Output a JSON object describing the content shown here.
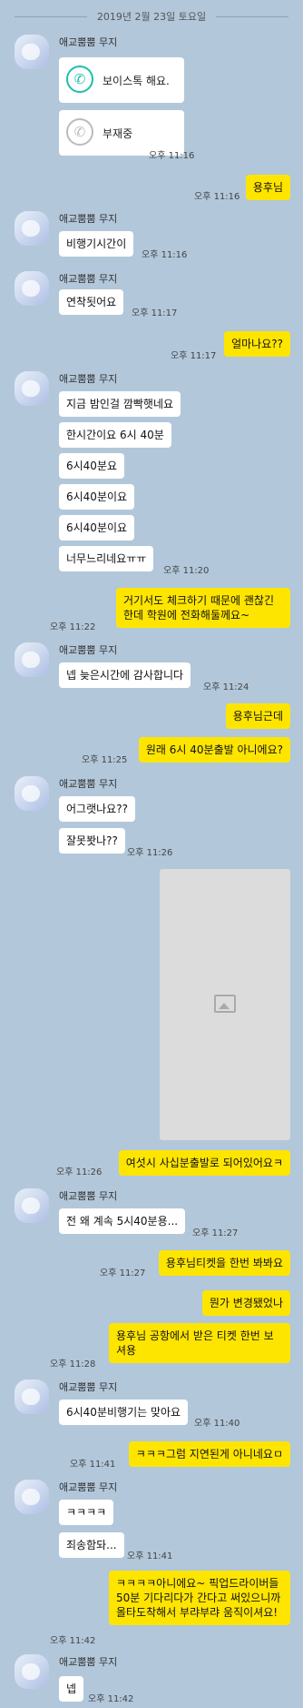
{
  "date_separator": "2019년 2월 23일 토요일",
  "sender_name": "애교뿜뿜 무지",
  "calls": [
    {
      "label": "보이스톡 해요.",
      "type": "voice-call"
    },
    {
      "label": "부재중",
      "type": "missed-call",
      "time": "오후 11:16"
    }
  ],
  "messages": {
    "m1": {
      "text": "용후님",
      "time": "오후 11:16"
    },
    "m2": {
      "text": "비행기시간이",
      "time": "오후 11:16"
    },
    "m3": {
      "text": "연착됫어요",
      "time": "오후 11:17"
    },
    "m4": {
      "text": "얼마나요??",
      "time": "오후 11:17"
    },
    "m5a": {
      "text": "지금 밤인걸 깜빡햇네요"
    },
    "m5b": {
      "text": "한시간이요 6시 40분"
    },
    "m5c": {
      "text": "6시40분요"
    },
    "m5d": {
      "text": "6시40분이요"
    },
    "m5e": {
      "text": "6시40분이요"
    },
    "m5f": {
      "text": "너무느리네요ㅠㅠ",
      "time": "오후 11:20"
    },
    "m6": {
      "text": "거기서도 체크하기 때문에 괜찮긴한데 학원에 전화해둘께요~",
      "time": "오후 11:22"
    },
    "m7": {
      "text": "넵 늦은시간에 감사합니다",
      "time": "오후 11:24"
    },
    "m8a": {
      "text": "용후님근데"
    },
    "m8b": {
      "text": "원래 6시 40분출발 아니에요?",
      "time": "오후 11:25"
    },
    "m9a": {
      "text": "어그랫나요??"
    },
    "m9b": {
      "text": "잘못봣나??",
      "time": "오후 11:26"
    },
    "m10": {
      "text": "여섯시 사십분출발로 되어있어요ㅋ",
      "time": "오후 11:26"
    },
    "m11": {
      "text": "전 왜 계속 5시40분용...",
      "time": "오후 11:27"
    },
    "m12": {
      "text": "용후님티켓을 한번 봐봐요",
      "time": "오후 11:27"
    },
    "m13a": {
      "text": "뭔가 변경됐었나"
    },
    "m13b": {
      "text": "용후님 공항에서 받은 티켓 한번 보셔용",
      "time": "오후 11:28"
    },
    "m14": {
      "text": "6시40분비행기는 맞아요",
      "time": "오후 11:40"
    },
    "m15": {
      "text": "ㅋㅋㅋ그럼 지연된게 아니네요ㅁ",
      "time": "오후 11:41"
    },
    "m16a": {
      "text": "ㅋㅋㅋㅋ"
    },
    "m16b": {
      "text": "죄송함돠...",
      "time": "오후 11:41"
    },
    "m17": {
      "text": "ㅋㅋㅋㅋ아니에요~ 픽업드라이버들 50분 기다리다가 간다고 써있으니까 올타도착해서 부랴부랴 움직이셔요!",
      "time": "오후 11:42"
    },
    "m18": {
      "text": "넵",
      "time": "오후 11:42"
    }
  },
  "image_message": {
    "icon": "image-placeholder-icon"
  },
  "colors": {
    "background": "#b2c7da",
    "outgoing": "#fee500",
    "incoming": "#ffffff",
    "call_icon": "#1ebfae"
  }
}
